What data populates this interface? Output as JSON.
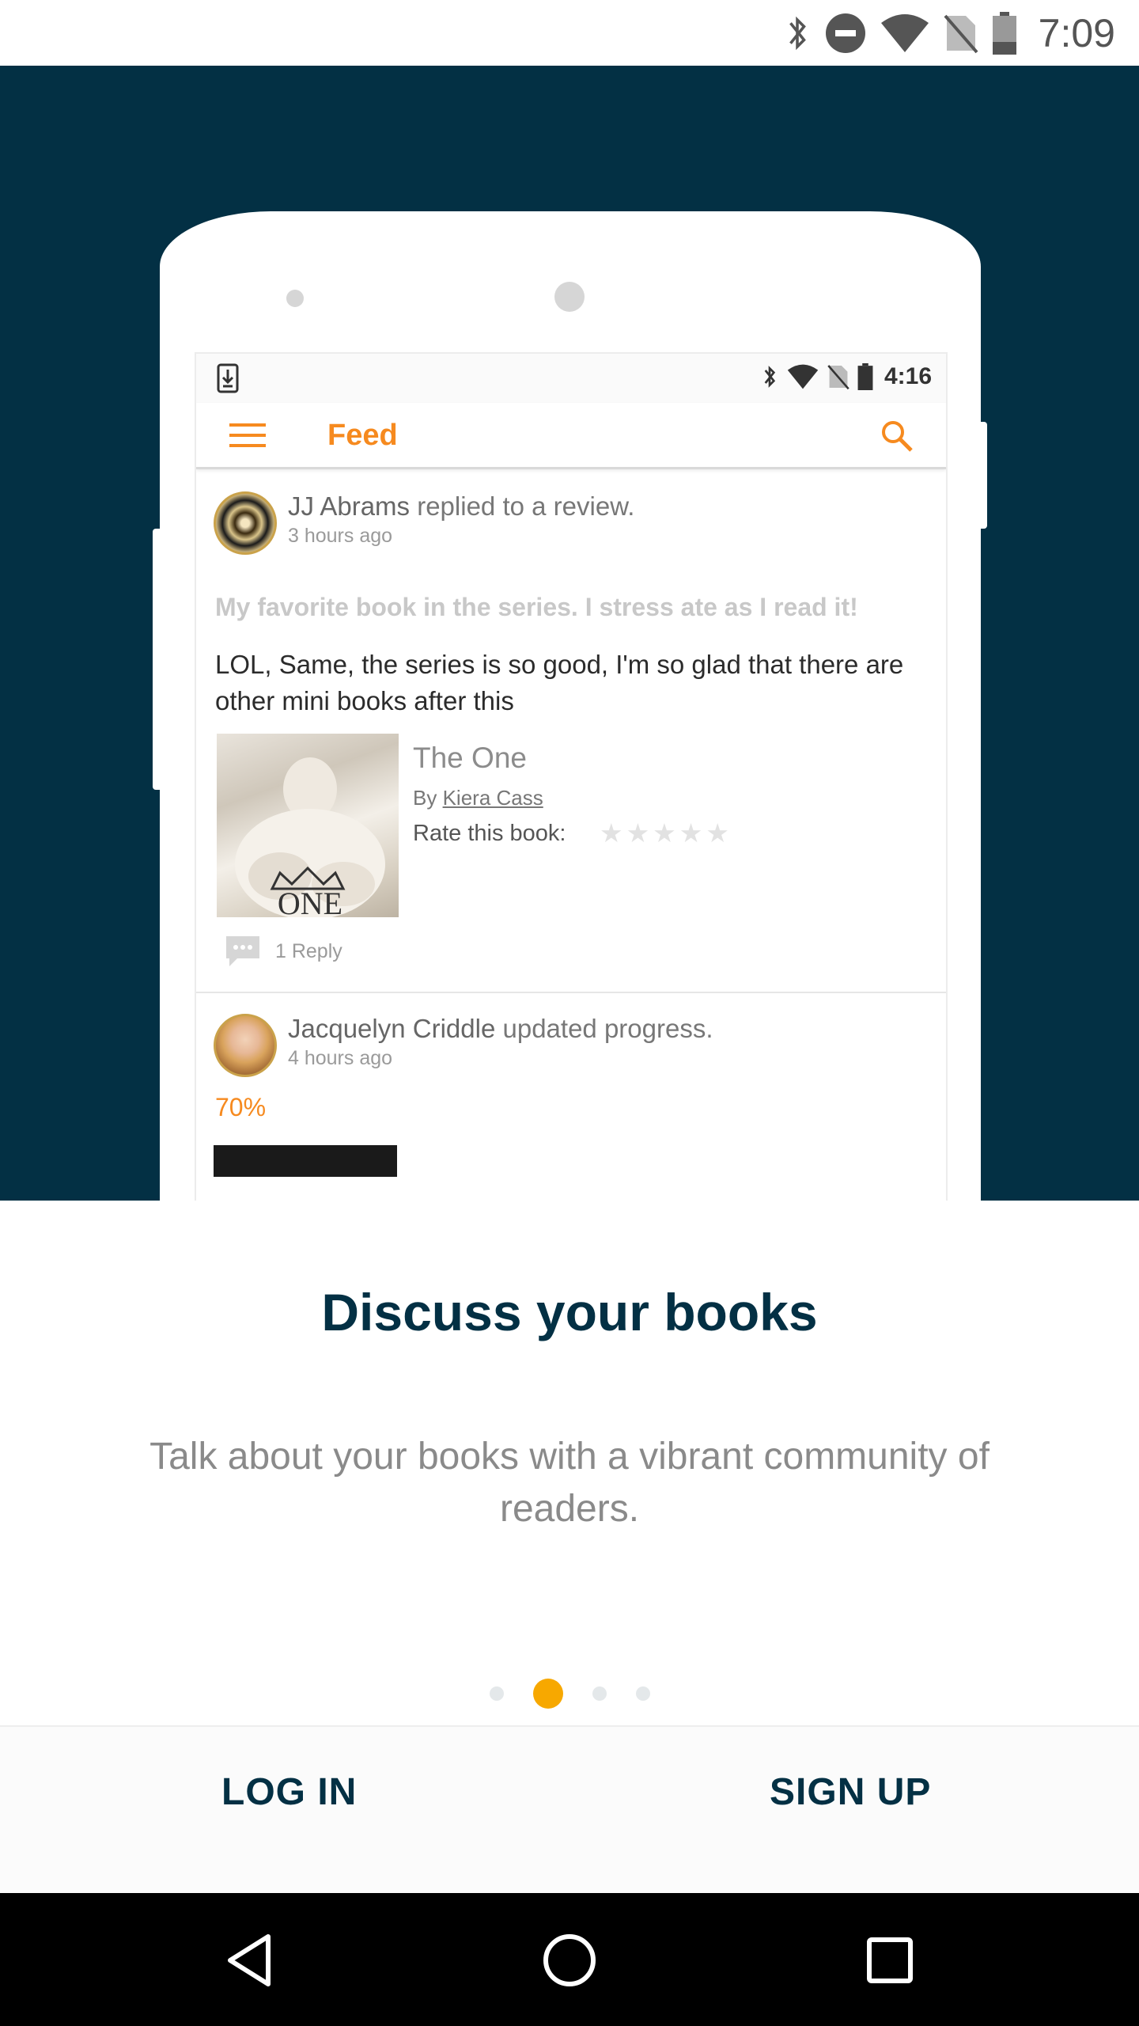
{
  "status_bar": {
    "time": "7:09",
    "icons": [
      "bluetooth-icon",
      "do-not-disturb-icon",
      "wifi-icon",
      "no-sim-icon",
      "battery-icon"
    ]
  },
  "mockup": {
    "status": {
      "time": "4:16"
    },
    "appbar": {
      "title": "Feed"
    },
    "feed": [
      {
        "user": "JJ Abrams",
        "action": "replied to a review.",
        "ago": "3 hours ago",
        "quote": "My favorite book in the series. I stress ate as I read it!",
        "reply": "LOL, Same, the series is so good, I'm so glad that there are other mini books after this",
        "book": {
          "title": "The One",
          "by_prefix": "By",
          "author": "Kiera Cass",
          "rate_label": "Rate this book:",
          "stars": "★★★★★",
          "cover_text": "ONE"
        },
        "replies": "1 Reply"
      },
      {
        "user": "Jacquelyn Criddle",
        "action": "updated progress.",
        "ago": "4 hours ago",
        "progress": "70%"
      }
    ]
  },
  "onboarding": {
    "title": "Discuss your books",
    "subtitle": "Talk about your books with a vibrant community of readers.",
    "page_count": 4,
    "active_page": 2
  },
  "actions": {
    "login": "LOG IN",
    "signup": "SIGN UP"
  },
  "colors": {
    "hero_bg": "#033044",
    "accent_orange": "#f68a1f",
    "dot_active": "#f7a800"
  }
}
